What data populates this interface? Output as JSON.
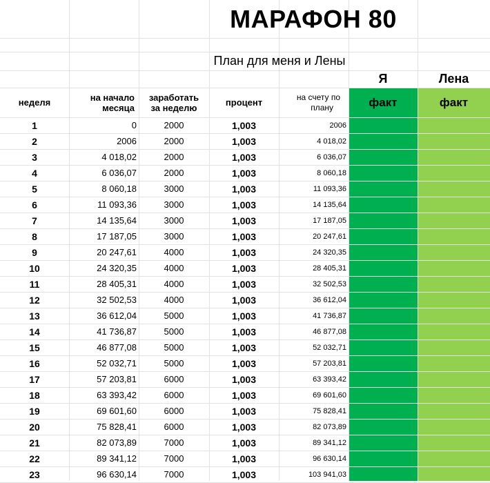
{
  "title": "МАРАФОН 80",
  "subtitle": "План для меня и Лены",
  "people": {
    "me": "Я",
    "lena": "Лена"
  },
  "headers": {
    "week": "неделя",
    "start_line1": "на начало",
    "start_line2": "месяца",
    "earn_line1": "заработать",
    "earn_line2": "за неделю",
    "percent": "процент",
    "plan_line1": "на счету по",
    "plan_line2": "плану",
    "fact_me": "факт",
    "fact_lena": "факт"
  },
  "colors": {
    "me_fact": "#00b050",
    "lena_fact": "#92d050"
  },
  "rows": [
    {
      "week": "1",
      "start": "0",
      "earn": "2000",
      "pct": "1,003",
      "plan": "2006"
    },
    {
      "week": "2",
      "start": "2006",
      "earn": "2000",
      "pct": "1,003",
      "plan": "4 018,02"
    },
    {
      "week": "3",
      "start": "4 018,02",
      "earn": "2000",
      "pct": "1,003",
      "plan": "6 036,07"
    },
    {
      "week": "4",
      "start": "6 036,07",
      "earn": "2000",
      "pct": "1,003",
      "plan": "8 060,18"
    },
    {
      "week": "5",
      "start": "8 060,18",
      "earn": "3000",
      "pct": "1,003",
      "plan": "11 093,36"
    },
    {
      "week": "6",
      "start": "11 093,36",
      "earn": "3000",
      "pct": "1,003",
      "plan": "14 135,64"
    },
    {
      "week": "7",
      "start": "14 135,64",
      "earn": "3000",
      "pct": "1,003",
      "plan": "17 187,05"
    },
    {
      "week": "8",
      "start": "17 187,05",
      "earn": "3000",
      "pct": "1,003",
      "plan": "20 247,61"
    },
    {
      "week": "9",
      "start": "20 247,61",
      "earn": "4000",
      "pct": "1,003",
      "plan": "24 320,35"
    },
    {
      "week": "10",
      "start": "24 320,35",
      "earn": "4000",
      "pct": "1,003",
      "plan": "28 405,31"
    },
    {
      "week": "11",
      "start": "28 405,31",
      "earn": "4000",
      "pct": "1,003",
      "plan": "32 502,53"
    },
    {
      "week": "12",
      "start": "32 502,53",
      "earn": "4000",
      "pct": "1,003",
      "plan": "36 612,04"
    },
    {
      "week": "13",
      "start": "36 612,04",
      "earn": "5000",
      "pct": "1,003",
      "plan": "41 736,87"
    },
    {
      "week": "14",
      "start": "41 736,87",
      "earn": "5000",
      "pct": "1,003",
      "plan": "46 877,08"
    },
    {
      "week": "15",
      "start": "46 877,08",
      "earn": "5000",
      "pct": "1,003",
      "plan": "52 032,71"
    },
    {
      "week": "16",
      "start": "52 032,71",
      "earn": "5000",
      "pct": "1,003",
      "plan": "57 203,81"
    },
    {
      "week": "17",
      "start": "57 203,81",
      "earn": "6000",
      "pct": "1,003",
      "plan": "63 393,42"
    },
    {
      "week": "18",
      "start": "63 393,42",
      "earn": "6000",
      "pct": "1,003",
      "plan": "69 601,60"
    },
    {
      "week": "19",
      "start": "69 601,60",
      "earn": "6000",
      "pct": "1,003",
      "plan": "75 828,41"
    },
    {
      "week": "20",
      "start": "75 828,41",
      "earn": "6000",
      "pct": "1,003",
      "plan": "82 073,89"
    },
    {
      "week": "21",
      "start": "82 073,89",
      "earn": "7000",
      "pct": "1,003",
      "plan": "89 341,12"
    },
    {
      "week": "22",
      "start": "89 341,12",
      "earn": "7000",
      "pct": "1,003",
      "plan": "96 630,14"
    },
    {
      "week": "23",
      "start": "96 630,14",
      "earn": "7000",
      "pct": "1,003",
      "plan": "103 941,03"
    }
  ]
}
